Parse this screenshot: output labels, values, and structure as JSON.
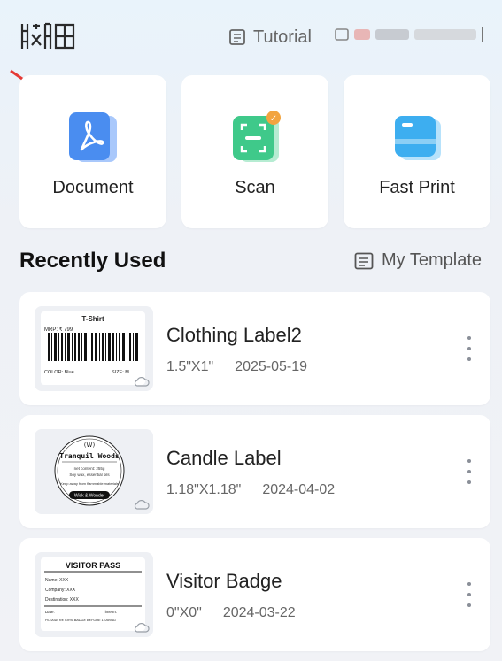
{
  "header": {
    "logo_text": "斗码",
    "tutorial_label": "Tutorial"
  },
  "actions": [
    {
      "label": "Document",
      "icon": "pdf-document-icon"
    },
    {
      "label": "Scan",
      "icon": "scan-icon"
    },
    {
      "label": "Fast Print",
      "icon": "card-print-icon"
    }
  ],
  "recent": {
    "title": "Recently Used",
    "my_template_label": "My Template",
    "items": [
      {
        "name": "Clothing Label2",
        "size": "1.5\"X1\"",
        "date": "2025-05-19",
        "thumb": {
          "title": "T-Shirt",
          "price": "MRP: ₹ 799",
          "color": "COLOR: Blue",
          "size": "SIZE: M"
        }
      },
      {
        "name": "Candle Label",
        "size": "1.18\"X1.18\"",
        "date": "2024-04-02",
        "thumb": {
          "brand": "Tranquil Woods",
          "net": "net content: 255g",
          "notes": "Soy wax, essential oils",
          "warning": "Keep away from flammable materials",
          "tag": "Wick & Wonder"
        }
      },
      {
        "name": "Visitor Badge",
        "size": "0\"X0\"",
        "date": "2024-03-22",
        "thumb": {
          "title": "VISITOR PASS",
          "name": "Name: XXX",
          "company": "Company: XXX",
          "destination": "Destination: XXX",
          "date": "Date:",
          "time": "Time In:",
          "note": "PLEASE RETURN BADGE BEFORE LEAVING"
        }
      }
    ]
  },
  "colors": {
    "accent_blue": "#4a8df0",
    "scan_green": "#3fc98a",
    "badge_orange": "#f2a440",
    "arrow_red": "#e53935"
  }
}
